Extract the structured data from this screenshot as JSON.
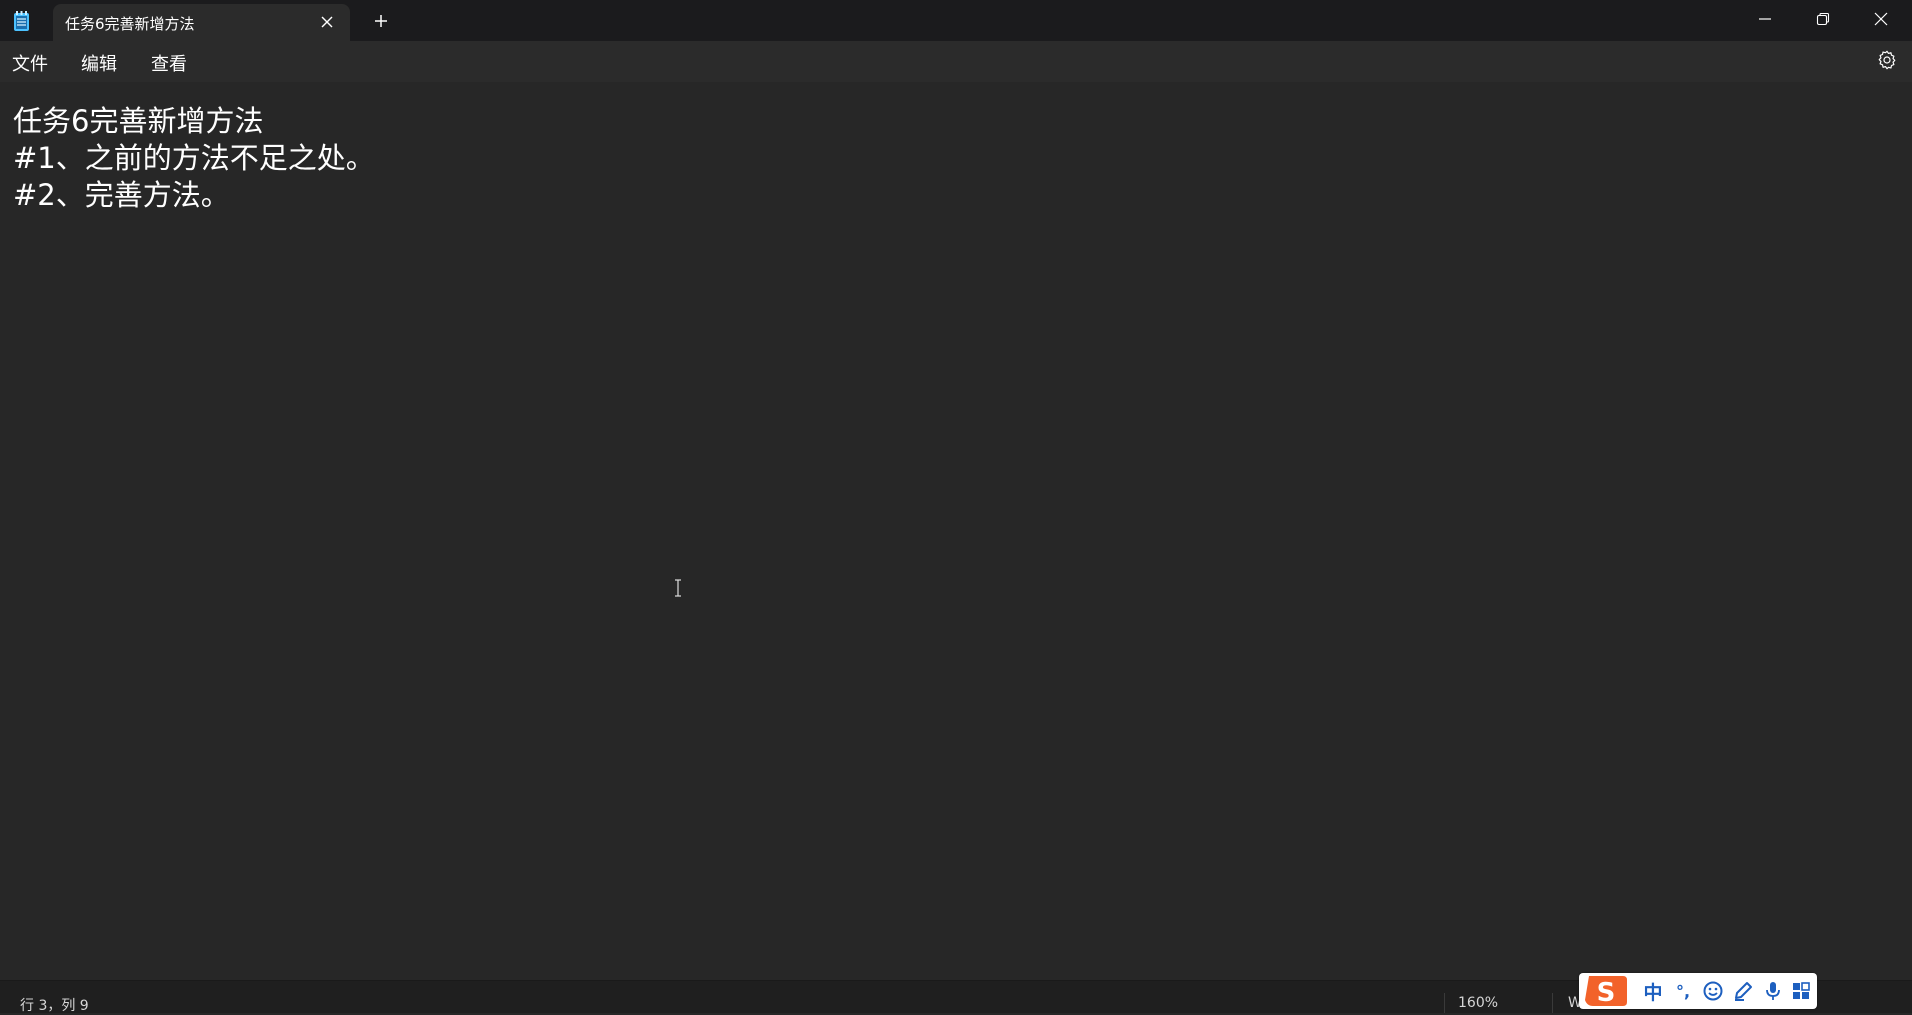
{
  "window": {
    "tab_title": "任务6完善新增方法",
    "controls": [
      "minimize-icon",
      "restore-icon",
      "close-icon"
    ]
  },
  "menu": {
    "file": "文件",
    "edit": "编辑",
    "view": "查看"
  },
  "editor": {
    "lines": [
      "任务6完善新增方法",
      "#1、之前的方法不足之处。",
      "#2、完善方法。"
    ]
  },
  "status": {
    "position": "行 3，列 9",
    "zoom": "160%",
    "encoding_partial": "W"
  },
  "ime": {
    "mode": "中",
    "punct": "°,",
    "icons": [
      "sogou-logo-icon",
      "emoji-icon",
      "pen-icon",
      "microphone-icon",
      "toolbox-icon"
    ]
  },
  "colors": {
    "titlebar": "#1b1b1d",
    "tab_active": "#2b2b2b",
    "menubar": "#2b2b2b",
    "editor_bg": "#272727",
    "statusbar": "#1f1f1f",
    "ime_accent": "#1d5fbf",
    "sogou_orange": "#f2622a"
  }
}
